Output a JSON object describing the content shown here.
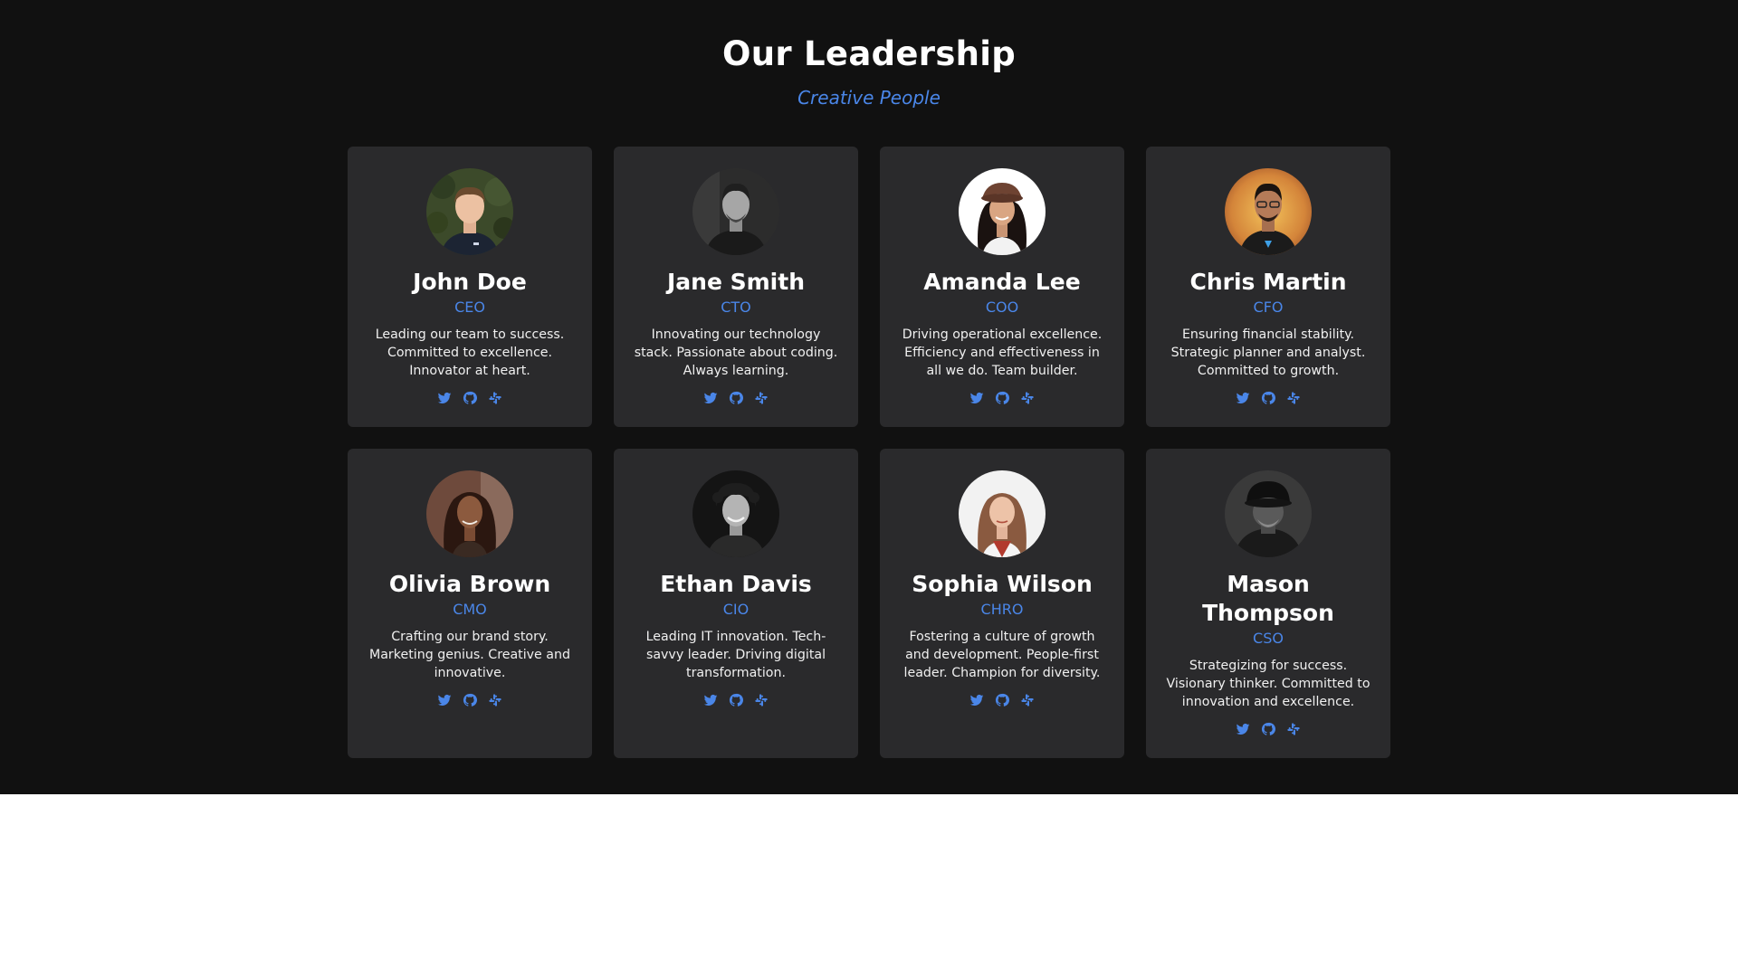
{
  "header": {
    "title": "Our Leadership",
    "subtitle": "Creative People"
  },
  "colors": {
    "background": "#111111",
    "card": "#2a2a2c",
    "accent": "#4a86e8",
    "text": "#ffffff"
  },
  "team": [
    {
      "name": "John Doe",
      "role": "CEO",
      "bio": "Leading our team to success. Committed to excellence. Innovator at heart.",
      "photo": "man-photo",
      "socials": [
        "twitter-icon",
        "github-icon",
        "slack-icon"
      ]
    },
    {
      "name": "Jane Smith",
      "role": "CTO",
      "bio": "Innovating our technology stack. Passionate about coding. Always learning.",
      "photo": "man-photo",
      "socials": [
        "twitter-icon",
        "github-icon",
        "slack-icon"
      ]
    },
    {
      "name": "Amanda Lee",
      "role": "COO",
      "bio": "Driving operational excellence. Efficiency and effectiveness in all we do. Team builder.",
      "photo": "woman-photo",
      "socials": [
        "twitter-icon",
        "github-icon",
        "slack-icon"
      ]
    },
    {
      "name": "Chris Martin",
      "role": "CFO",
      "bio": "Ensuring financial stability. Strategic planner and analyst. Committed to growth.",
      "photo": "man-photo",
      "socials": [
        "twitter-icon",
        "github-icon",
        "slack-icon"
      ]
    },
    {
      "name": "Olivia Brown",
      "role": "CMO",
      "bio": "Crafting our brand story. Marketing genius. Creative and innovative.",
      "photo": "woman-photo",
      "socials": [
        "twitter-icon",
        "github-icon",
        "slack-icon"
      ]
    },
    {
      "name": "Ethan Davis",
      "role": "CIO",
      "bio": "Leading IT innovation. Tech-savvy leader. Driving digital transformation.",
      "photo": "man-photo",
      "socials": [
        "twitter-icon",
        "github-icon",
        "slack-icon"
      ]
    },
    {
      "name": "Sophia Wilson",
      "role": "CHRO",
      "bio": "Fostering a culture of growth and development. People-first leader. Champion for diversity.",
      "photo": "woman-photo",
      "socials": [
        "twitter-icon",
        "github-icon",
        "slack-icon"
      ]
    },
    {
      "name": "Mason Thompson",
      "role": "CSO",
      "bio": "Strategizing for success. Visionary thinker. Committed to innovation and excellence.",
      "photo": "man-photo",
      "socials": [
        "twitter-icon",
        "github-icon",
        "slack-icon"
      ]
    }
  ]
}
